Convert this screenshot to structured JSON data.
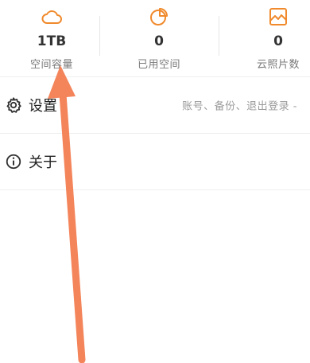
{
  "stats": [
    {
      "icon": "cloud-icon",
      "value": "1TB",
      "label": "空间容量"
    },
    {
      "icon": "pie-chart-icon",
      "value": "0",
      "label": "已用空间"
    },
    {
      "icon": "photo-icon",
      "value": "0",
      "label": "云照片数"
    }
  ],
  "menu": {
    "settings": {
      "label": "设置",
      "description": "账号、备份、退出登录 -"
    },
    "about": {
      "label": "关于"
    }
  },
  "colors": {
    "accent": "#F08A2C",
    "arrow": "#F4845A"
  }
}
